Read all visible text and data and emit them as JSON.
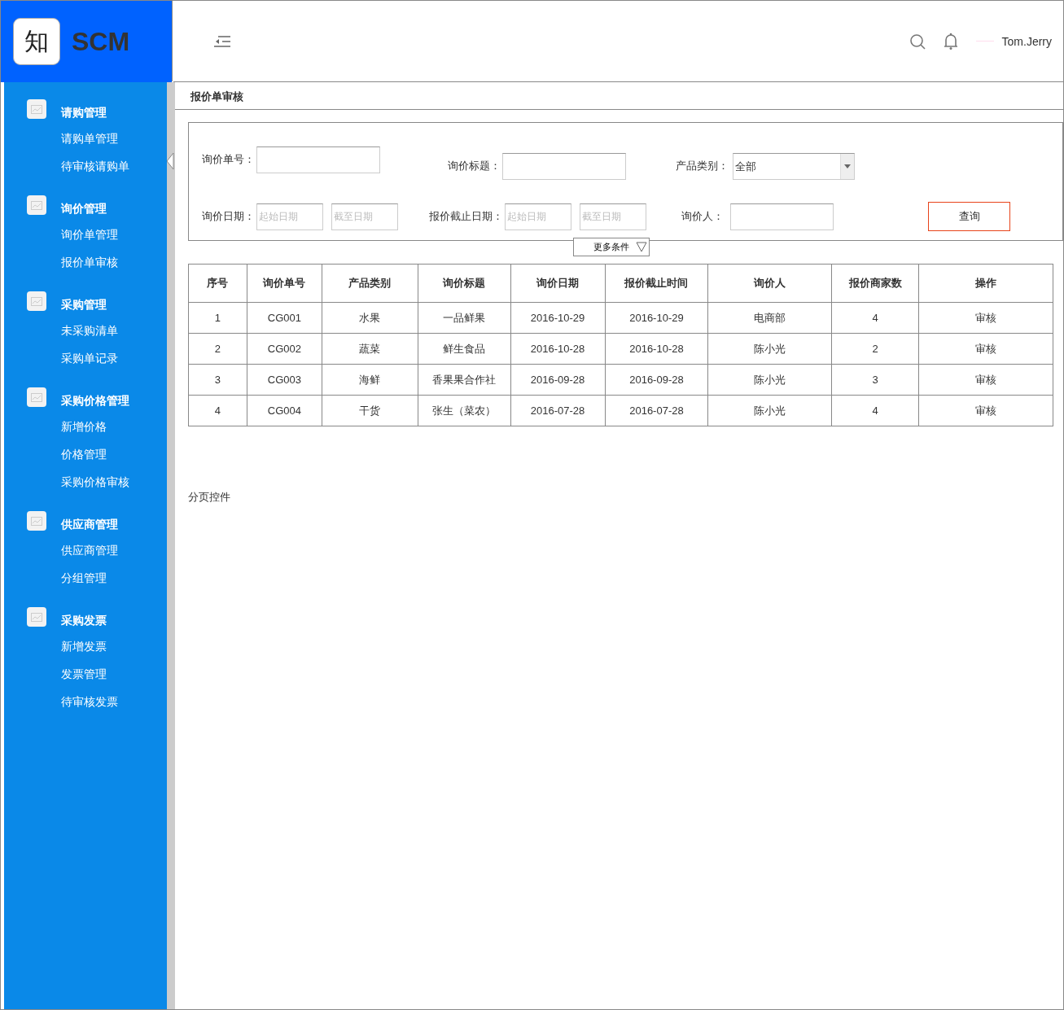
{
  "logo": {
    "mark": "知",
    "title": "SCM"
  },
  "sidebar": {
    "groups": [
      {
        "title": "请购管理",
        "items": [
          {
            "label": "请购单管理"
          },
          {
            "label": "待审核请购单"
          }
        ]
      },
      {
        "title": "询价管理",
        "items": [
          {
            "label": "询价单管理"
          },
          {
            "label": "报价单审核"
          }
        ]
      },
      {
        "title": "采购管理",
        "items": [
          {
            "label": "未采购清单"
          },
          {
            "label": "采购单记录"
          }
        ]
      },
      {
        "title": "采购价格管理",
        "items": [
          {
            "label": "新增价格"
          },
          {
            "label": "价格管理"
          },
          {
            "label": "采购价格审核"
          }
        ]
      },
      {
        "title": "供应商管理",
        "items": [
          {
            "label": "供应商管理"
          },
          {
            "label": "分组管理"
          }
        ]
      },
      {
        "title": "采购发票",
        "items": [
          {
            "label": "新增发票"
          },
          {
            "label": "发票管理"
          },
          {
            "label": "待审核发票"
          }
        ]
      }
    ]
  },
  "header": {
    "user": "Tom.Jerry"
  },
  "breadcrumb": "报价单审核",
  "filters": {
    "inquiry_no": {
      "label": "询价单号："
    },
    "inquiry_title": {
      "label": "询价标题："
    },
    "category": {
      "label": "产品类别：",
      "value": "全部"
    },
    "inquiry_date": {
      "label": "询价日期：",
      "from_placeholder": "起始日期",
      "to_placeholder": "截至日期"
    },
    "deadline": {
      "label": "报价截止日期：",
      "from_placeholder": "起始日期",
      "to_placeholder": "截至日期"
    },
    "inquirer": {
      "label": "询价人："
    },
    "search_button": "查询",
    "more": "更多条件"
  },
  "table": {
    "columns": [
      "序号",
      "询价单号",
      "产品类别",
      "询价标题",
      "询价日期",
      "报价截止时间",
      "询价人",
      "报价商家数",
      "操作"
    ],
    "rows": [
      [
        "1",
        "CG001",
        "水果",
        "一品鲜果",
        "2016-10-29",
        "2016-10-29",
        "电商部",
        "4",
        "审核"
      ],
      [
        "2",
        "CG002",
        "蔬菜",
        "鲜生食品",
        "2016-10-28",
        "2016-10-28",
        "陈小光",
        "2",
        "审核"
      ],
      [
        "3",
        "CG003",
        "海鲜",
        "香果果合作社",
        "2016-09-28",
        "2016-09-28",
        "陈小光",
        "3",
        "审核"
      ],
      [
        "4",
        "CG004",
        "干货",
        "张生（菜农）",
        "2016-07-28",
        "2016-07-28",
        "陈小光",
        "4",
        "审核"
      ]
    ]
  },
  "pagination": "分页控件"
}
